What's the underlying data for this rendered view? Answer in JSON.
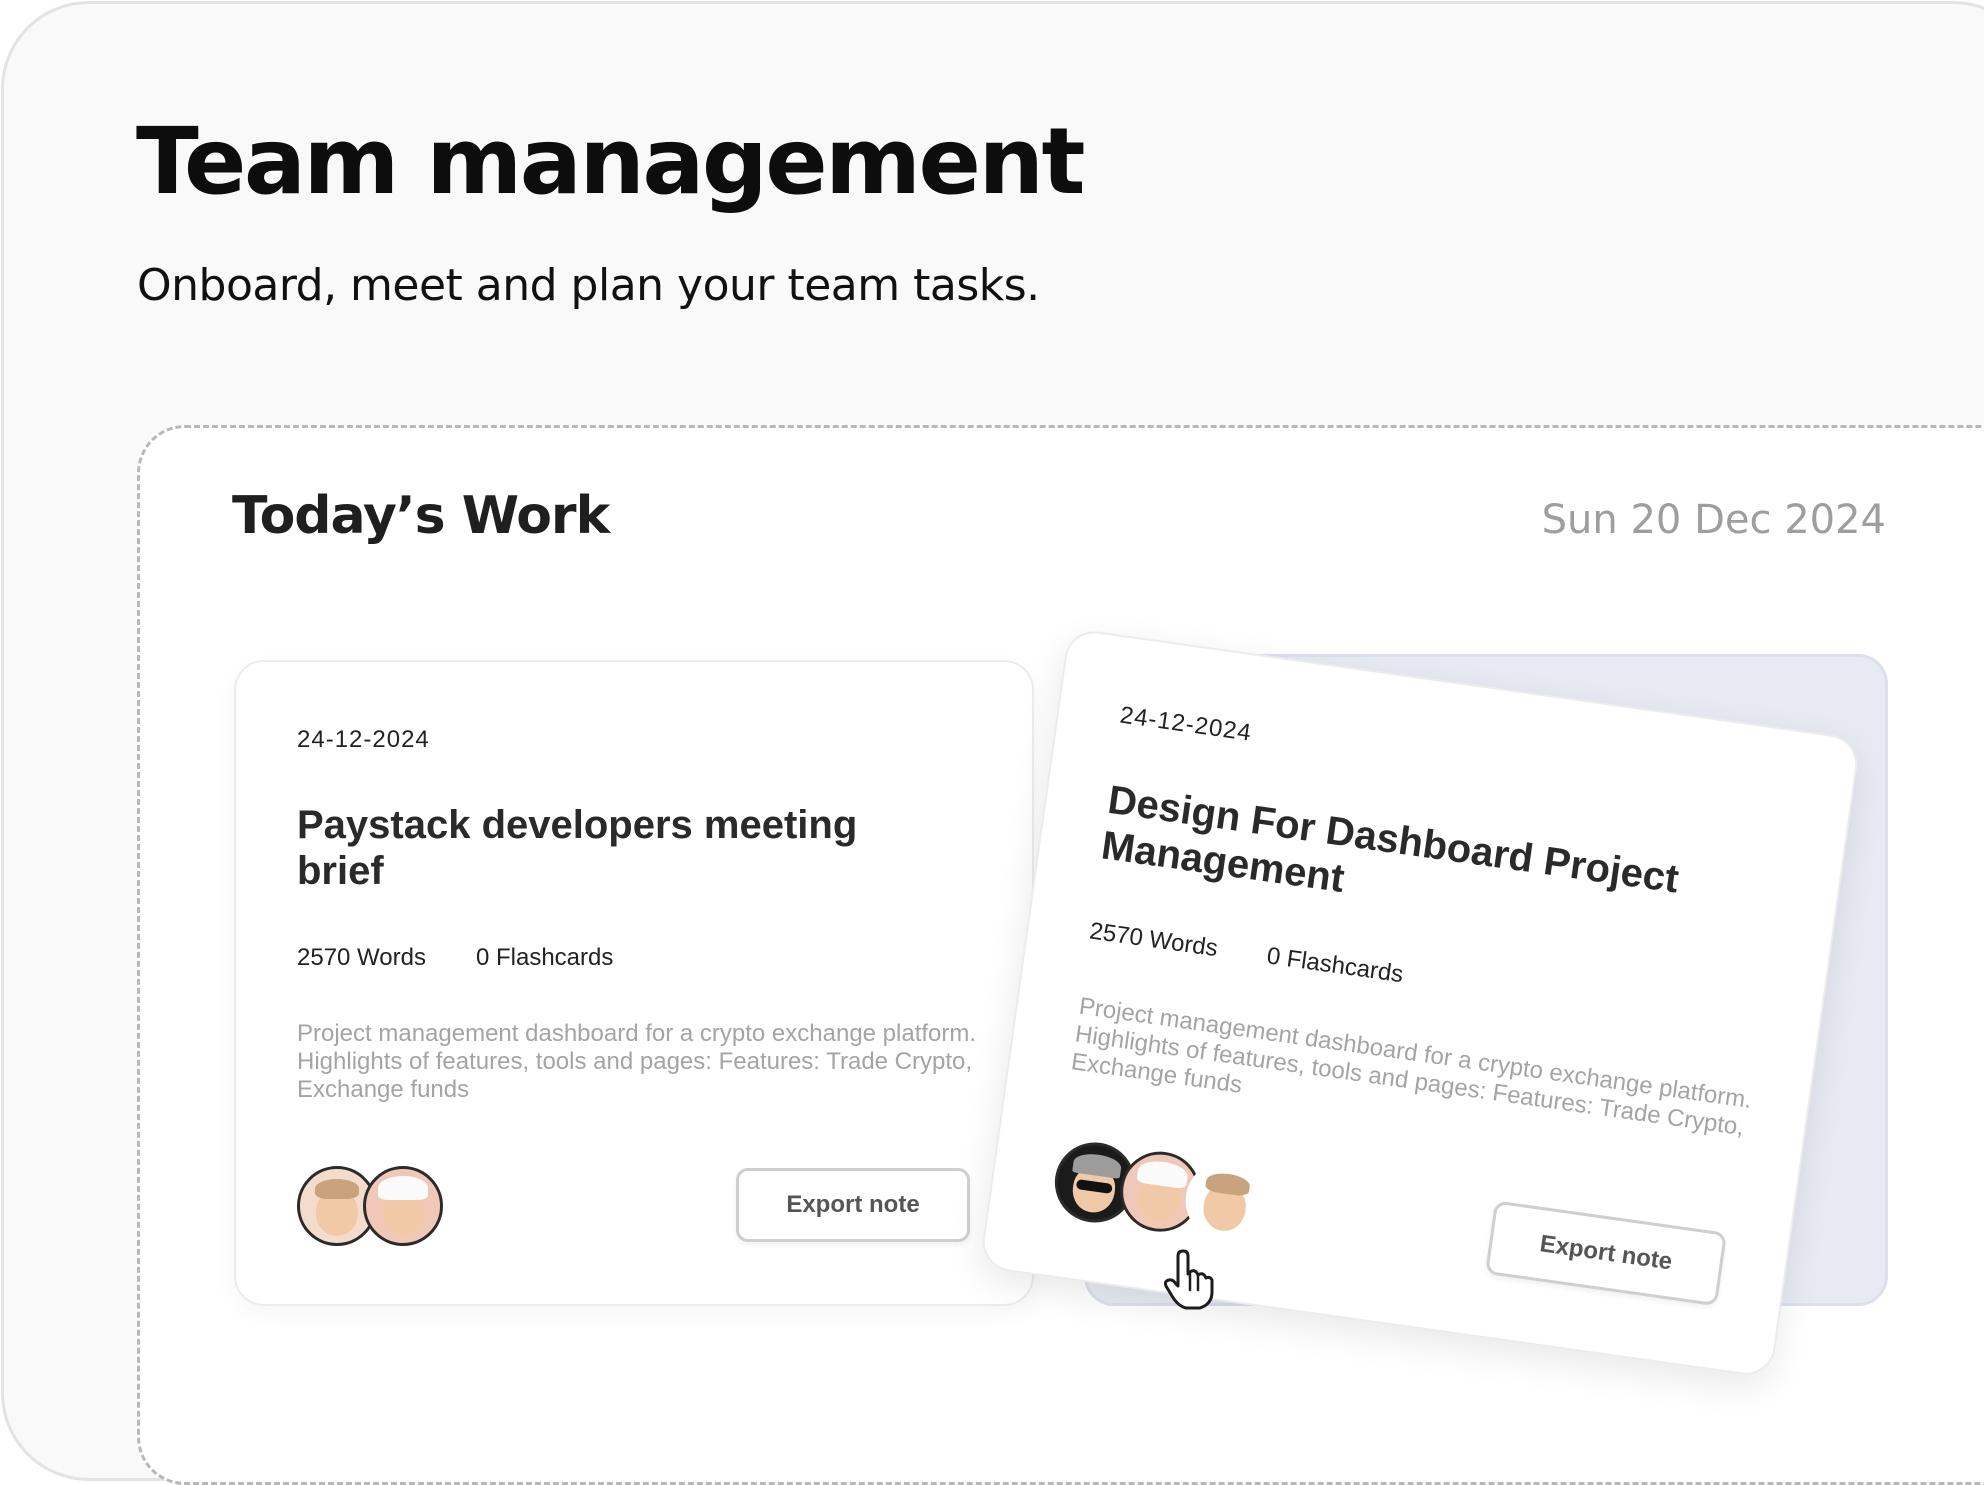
{
  "hero": {
    "title": "Team management",
    "subtitle": "Onboard, meet and plan your team tasks."
  },
  "panel": {
    "title": "Today’s Work",
    "date": "Sun 20 Dec 2024"
  },
  "cards": [
    {
      "date": "24-12-2024",
      "title": "Paystack developers meeting brief",
      "words": "2570 Words",
      "flashcards": "0 Flashcards",
      "description": "Project management dashboard for a crypto exchange platform. Highlights of features, tools and pages: Features: Trade Crypto, Exchange funds",
      "avatars": [
        "memoji-peace-sign",
        "memoji-white-hat"
      ],
      "button_label": "Export note"
    },
    {
      "date": "24-12-2024",
      "title": "Design For Dashboard Project Management",
      "words": "2570 Words",
      "flashcards": "0 Flashcards",
      "description": "Project management dashboard for a crypto exchange platform. Highlights of features, tools and pages: Features: Trade Crypto, Exchange funds",
      "avatars": [
        "memoji-cap-sunglasses",
        "memoji-white-hat",
        "memoji-peace-sign"
      ],
      "button_label": "Export note"
    }
  ],
  "cursor": {
    "icon": "hand-pointer-icon"
  },
  "colors": {
    "page_background": "#f9f9f9",
    "panel_background": "#ffffff",
    "back_card": "#e7eaf3",
    "muted_text": "#a4a4a4"
  }
}
